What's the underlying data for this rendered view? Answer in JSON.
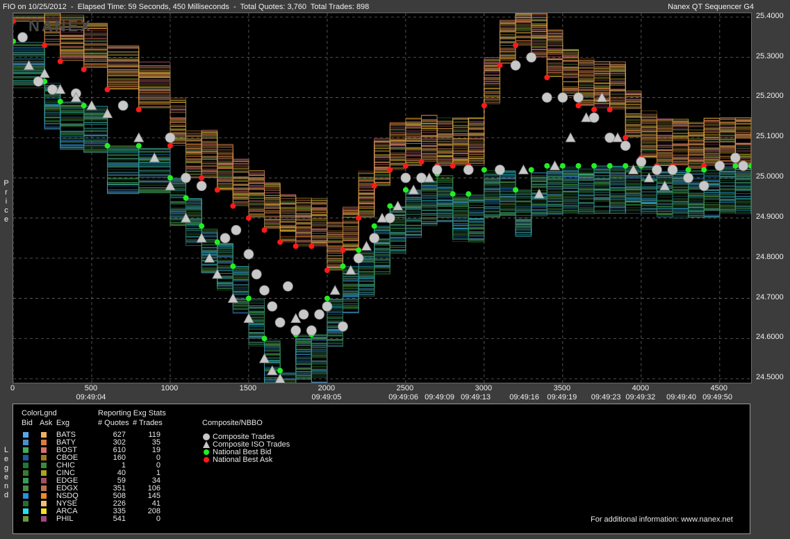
{
  "header": {
    "left": "FIO on 10/25/2012  -  Elapsed Time: 59 Seconds, 450 Milliseconds  -  Total Quotes: 3,760  Total Trades: 898",
    "right": "Nanex QT Sequencer G4",
    "watermark": "NANEX"
  },
  "axis": {
    "y_label": "Price",
    "y_ticks": [
      "25.4000",
      "25.3000",
      "25.2000",
      "25.1000",
      "25.0000",
      "24.9000",
      "24.8000",
      "24.7000",
      "24.6000",
      "24.5000"
    ],
    "x_ticks": [
      "0",
      "500",
      "1000",
      "1500",
      "2000",
      "2500",
      "3000",
      "3500",
      "4000",
      "4500"
    ],
    "time_ticks": [
      {
        "label": "09:49:04",
        "seq": 500
      },
      {
        "label": "09:49:05",
        "seq": 2000
      },
      {
        "label": "09:49:06",
        "seq": 2490
      },
      {
        "label": "09:49:09",
        "seq": 2720
      },
      {
        "label": "09:49:13",
        "seq": 2950
      },
      {
        "label": "09:49:16",
        "seq": 3260
      },
      {
        "label": "09:49:19",
        "seq": 3500
      },
      {
        "label": "09:49:23",
        "seq": 3780
      },
      {
        "label": "09:49:32",
        "seq": 4000
      },
      {
        "label": "09:49:40",
        "seq": 4260
      },
      {
        "label": "09:49:50",
        "seq": 4490
      }
    ]
  },
  "legend": {
    "side_label": "Legend",
    "header_colorlgnd": "ColorLgnd",
    "header_bid": "Bid",
    "header_ask": "Ask",
    "header_exg": "Exg",
    "header_reporting": "Reporting Exg Stats",
    "header_quotes": "# Quotes",
    "header_trades": "# Trades",
    "composite_title": "Composite/NBBO",
    "composite_items": [
      {
        "label": "Composite Trades",
        "color": "#c8c8c8"
      },
      {
        "label": "Composite ISO Trades",
        "color": "#c8c8c8"
      },
      {
        "label": "National Best Bid",
        "color": "#22ee22"
      },
      {
        "label": "National Best Ask",
        "color": "#ff1a1a"
      }
    ],
    "footer": "For additional information: www.nanex.net",
    "rows": [
      {
        "exg": "BATS",
        "quotes": "627",
        "trades": "119",
        "bid": "#5aa8e6",
        "ask": "#f0b060"
      },
      {
        "exg": "BATY",
        "quotes": "302",
        "trades": "35",
        "bid": "#4a8ec8",
        "ask": "#e07a3a"
      },
      {
        "exg": "BOST",
        "quotes": "610",
        "trades": "19",
        "bid": "#3fae5a",
        "ask": "#d87070"
      },
      {
        "exg": "CBOE",
        "quotes": "160",
        "trades": "0",
        "bid": "#1a5aa0",
        "ask": "#a07a20"
      },
      {
        "exg": "CHIC",
        "quotes": "1",
        "trades": "0",
        "bid": "#1e7a3a",
        "ask": "#3a8a3a"
      },
      {
        "exg": "CINC",
        "quotes": "40",
        "trades": "1",
        "bid": "#3a7a2a",
        "ask": "#b0a020"
      },
      {
        "exg": "EDGE",
        "quotes": "59",
        "trades": "34",
        "bid": "#3a9a5a",
        "ask": "#a05060"
      },
      {
        "exg": "EDGX",
        "quotes": "351",
        "trades": "106",
        "bid": "#4a8a4a",
        "ask": "#c07050"
      },
      {
        "exg": "NSDQ",
        "quotes": "508",
        "trades": "145",
        "bid": "#2a90e0",
        "ask": "#f08a2a"
      },
      {
        "exg": "NYSE",
        "quotes": "226",
        "trades": "41",
        "bid": "#2a6a2a",
        "ask": "#f0c070"
      },
      {
        "exg": "ARCA",
        "quotes": "335",
        "trades": "208",
        "bid": "#20e0f0",
        "ask": "#f0e020"
      },
      {
        "exg": "PHIL",
        "quotes": "541",
        "trades": "0",
        "bid": "#6a9a3a",
        "ask": "#a04a80"
      }
    ]
  },
  "chart_data": {
    "type": "scatter",
    "title": "FIO on 10/25/2012",
    "ylabel": "Price",
    "xlabel": "",
    "xlim": [
      0,
      4700
    ],
    "ylim": [
      24.49,
      25.41
    ],
    "grid": true,
    "series": [
      {
        "name": "National Best Ask",
        "color": "#ff1a1a",
        "x": [
          0,
          200,
          300,
          450,
          600,
          800,
          1000,
          1100,
          1200,
          1300,
          1400,
          1500,
          1600,
          1700,
          1800,
          1900,
          2000,
          2100,
          2200,
          2300,
          2400,
          2500,
          2600,
          2700,
          2800,
          2900,
          3000,
          3100,
          3200,
          3300,
          3400,
          3500,
          3600,
          3700,
          3800,
          3900,
          4000,
          4100,
          4200,
          4300,
          4400,
          4500,
          4600,
          4700
        ],
        "y": [
          25.39,
          25.33,
          25.29,
          25.27,
          25.22,
          25.17,
          25.08,
          25.0,
          25.0,
          24.97,
          24.93,
          24.9,
          24.87,
          24.84,
          24.83,
          24.83,
          24.77,
          24.82,
          24.9,
          24.98,
          25.02,
          25.03,
          25.04,
          25.03,
          25.03,
          25.03,
          25.18,
          25.28,
          25.33,
          25.3,
          25.25,
          25.2,
          25.18,
          25.17,
          25.17,
          25.1,
          25.05,
          25.03,
          25.03,
          25.02,
          25.03,
          25.03,
          25.03,
          25.03
        ]
      },
      {
        "name": "National Best Bid",
        "color": "#22ee22",
        "x": [
          0,
          200,
          300,
          450,
          600,
          800,
          1000,
          1100,
          1200,
          1300,
          1400,
          1500,
          1600,
          1700,
          1800,
          1900,
          2000,
          2100,
          2200,
          2300,
          2400,
          2500,
          2600,
          2700,
          2800,
          2900,
          3000,
          3100,
          3200,
          3300,
          3400,
          3500,
          3600,
          3700,
          3800,
          3900,
          4000,
          4100,
          4200,
          4300,
          4400,
          4500,
          4600,
          4700
        ],
        "y": [
          25.34,
          25.24,
          25.19,
          25.18,
          25.08,
          25.08,
          25.0,
          24.95,
          24.88,
          24.84,
          24.78,
          24.7,
          24.6,
          24.52,
          24.61,
          24.61,
          24.7,
          24.78,
          24.82,
          24.88,
          24.93,
          24.97,
          25.0,
          25.01,
          24.96,
          24.96,
          25.02,
          25.02,
          24.97,
          25.02,
          25.03,
          25.03,
          25.03,
          25.03,
          25.03,
          25.03,
          25.03,
          25.02,
          25.02,
          25.02,
          25.02,
          25.03,
          25.03,
          25.03
        ]
      },
      {
        "name": "Composite Trades",
        "color": "#c8c8c8",
        "x": [
          60,
          160,
          250,
          400,
          700,
          1000,
          1100,
          1200,
          1350,
          1420,
          1500,
          1550,
          1600,
          1650,
          1700,
          1750,
          1800,
          1850,
          1900,
          1950,
          2000,
          2100,
          2200,
          2300,
          2400,
          2500,
          2600,
          2700,
          2900,
          3100,
          3200,
          3300,
          3400,
          3500,
          3600,
          3700,
          3800,
          3900,
          4000,
          4100,
          4200,
          4300,
          4400,
          4500,
          4600,
          4650
        ],
        "y": [
          25.35,
          25.24,
          25.22,
          25.21,
          25.18,
          25.1,
          25.0,
          24.98,
          24.85,
          24.87,
          24.81,
          24.76,
          24.72,
          24.68,
          24.64,
          24.73,
          24.62,
          24.66,
          24.62,
          24.66,
          24.68,
          24.63,
          24.8,
          24.85,
          24.9,
          25.0,
          25.0,
          25.02,
          25.02,
          25.02,
          25.28,
          25.3,
          25.2,
          25.2,
          25.2,
          25.15,
          25.1,
          25.08,
          25.04,
          25.02,
          25.02,
          25.0,
          24.98,
          25.03,
          25.05,
          25.03
        ]
      },
      {
        "name": "Composite ISO Trades",
        "color": "#c8c8c8",
        "x": [
          100,
          200,
          300,
          400,
          500,
          600,
          800,
          900,
          1000,
          1100,
          1200,
          1250,
          1300,
          1400,
          1500,
          1600,
          1650,
          1700,
          1800,
          2050,
          2150,
          2250,
          2350,
          2450,
          2550,
          2650,
          3250,
          3350,
          3450,
          3550,
          3650,
          3750,
          3850,
          3950,
          4050,
          4150
        ],
        "y": [
          25.28,
          25.26,
          25.22,
          25.2,
          25.18,
          25.16,
          25.1,
          25.05,
          24.98,
          24.9,
          24.85,
          24.8,
          24.76,
          24.7,
          24.65,
          24.55,
          24.52,
          24.5,
          24.65,
          24.72,
          24.77,
          24.83,
          24.9,
          24.93,
          24.97,
          25.0,
          25.02,
          24.96,
          25.03,
          25.1,
          25.15,
          25.2,
          25.1,
          25.02,
          25.0,
          24.98
        ]
      }
    ]
  }
}
